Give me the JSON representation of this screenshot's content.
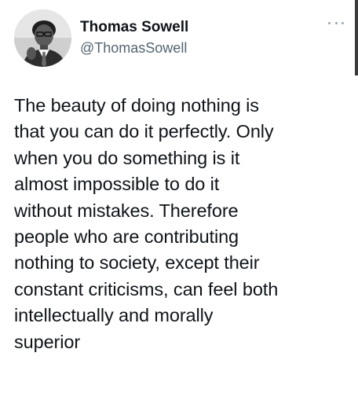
{
  "tweet": {
    "author": {
      "display_name": "Thomas Sowell",
      "handle": "@ThomasSowell",
      "avatar_icon": "portrait-photo"
    },
    "more_icon": "more-horizontal-icon",
    "text": "The beauty of doing nothing is\nthat you can do it perfectly. Only\nwhen you do something is it\nalmost impossible to do it\nwithout mistakes. Therefore\npeople who are contributing\nnothing to society, except their\nconstant criticisms, can feel both\nintellectually and morally\nsuperior"
  },
  "colors": {
    "text_primary": "#0f1419",
    "text_secondary": "#536471",
    "background": "#ffffff"
  }
}
